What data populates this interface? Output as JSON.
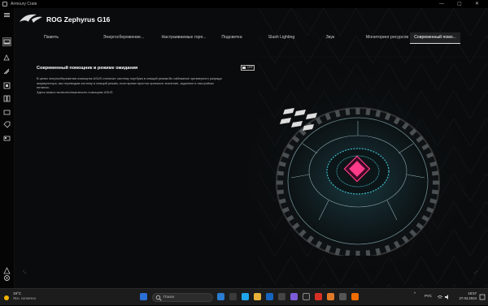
{
  "window": {
    "title": "Armoury Crate",
    "min": "—",
    "max": "▢",
    "close": "✕"
  },
  "header": {
    "title": "ROG Zephyrus G16"
  },
  "sidebar": {
    "items": [
      "home-icon",
      "device-icon",
      "lighting-icon",
      "gamevisual-icon",
      "scenario-icon",
      "media-icon",
      "deals-icon",
      "games-icon",
      "user-center-icon",
      "settings-icon"
    ]
  },
  "tabs": [
    "Память",
    "Энергосбережение...",
    "Настраиваемые горя...",
    "Подсветка",
    "Slash Lighting",
    "Звук",
    "Мониторинг ресурсов",
    "Современный помо..."
  ],
  "active_tab": 7,
  "setting": {
    "title": "Современный помощник в режиме ожидания",
    "toggle_state": "OFF",
    "desc_lines": [
      "В целях энергосбережения помощник ASUS отключит систему ноутбука в спящий режим.Во избежание чрезмерного разряда",
      "аккумулятора, мы переводим систему в спящий режим, если время простоя превысит значение, заданное в настройках",
      "питания.",
      "Здесь можно включить/выключить помощник ASUS"
    ]
  },
  "taskbar": {
    "weather_temp": "19°C",
    "weather_cond": "Ясн. солнечно",
    "search_placeholder": "Поиск",
    "lang": "РУС",
    "time": "18:57",
    "date": "27.04.2024"
  },
  "colors": {
    "accent": "#ff3b8a",
    "cyan": "#4fd8e8",
    "bg": "#0a0b0c"
  }
}
